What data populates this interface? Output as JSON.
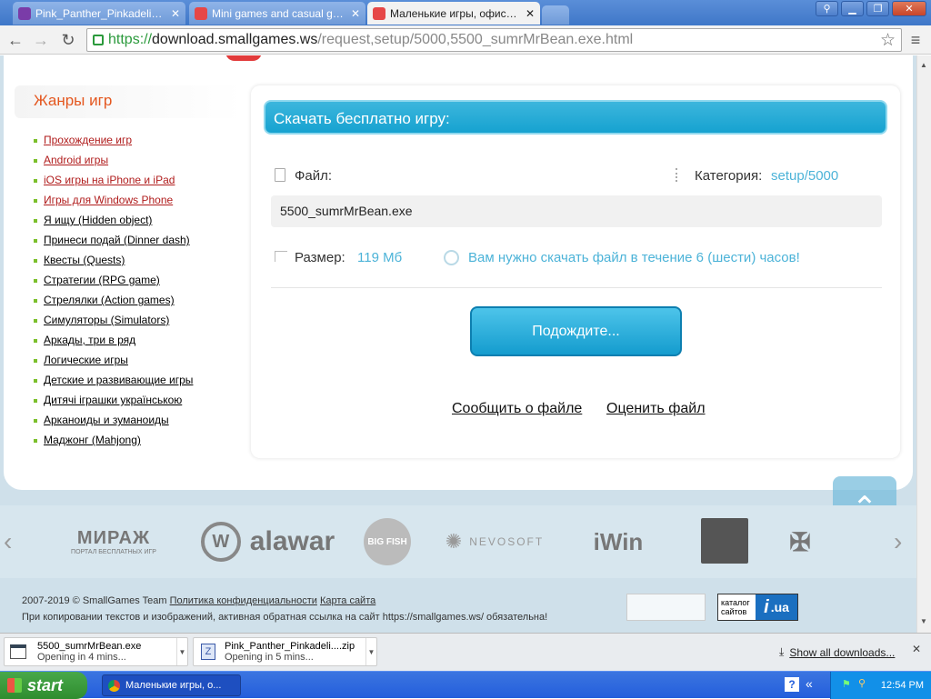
{
  "browser": {
    "tabs": [
      {
        "title": "Pink_Panther_Pinkadelic_Pur",
        "fav_color": "#7a3ca8"
      },
      {
        "title": "Mini games and casual games",
        "fav_color": "#e64747"
      },
      {
        "title": "Маленькие игры, офисные",
        "fav_color": "#e64747"
      }
    ],
    "url": {
      "scheme": "https://",
      "host": "download.smallgames.ws",
      "path": "/request,setup/5000,5500_sumrMrBean.exe.html"
    }
  },
  "sidebar": {
    "title": "Жанры игр",
    "genres": [
      "Прохождение игр",
      "Android игры",
      "iOS игры на iPhone и iPad",
      "Игры для Windows Phone",
      "Я ищу (Hidden object)",
      "Принеси подай (Dinner dash)",
      "Квесты (Quests)",
      "Стратегии (RPG game)",
      "Стрелялки (Action games)",
      "Симуляторы (Simulators)",
      "Аркады, три в ряд",
      "Логические игры",
      "Детские и развивающие игры",
      "Дитячі іграшки українською",
      "Арканоиды и зуманоиды",
      "Маджонг (Mahjong)"
    ]
  },
  "download": {
    "banner": "Скачать бесплатно игру:",
    "file_label": "Файл:",
    "category_label": "Категория:",
    "category_value": "setup/5000",
    "filename": "5500_sumrMrBean.exe",
    "size_label": "Размер:",
    "size_value": "119 Мб",
    "notice": "Вам нужно скачать файл в течение 6 (шести) часов!",
    "wait_button": "Подождите...",
    "report_link": "Сообщить о файле",
    "rate_link": "Оценить файл"
  },
  "partners": {
    "logos": [
      "МИРАЖ",
      "ПОРТАЛ БЕСПЛАТНЫХ ИГР",
      "alawar",
      "BIG FISH",
      "NEVOSOFT",
      "iWin"
    ]
  },
  "footer": {
    "copyright": "2007-2019 © SmallGames Team",
    "privacy": "Политика конфиденциальности",
    "sitemap": "Карта сайта",
    "notice": "При копировании текстов и изображений, активная обратная ссылка на сайт https://smallgames.ws/ обязательна!",
    "badge_text": "каталог сайтов",
    "badge_suffix": ".ua"
  },
  "downloads_bar": {
    "items": [
      {
        "name": "5500_sumrMrBean.exe",
        "status": "Opening in 4 mins..."
      },
      {
        "name": "Pink_Panther_Pinkadeli....zip",
        "status": "Opening in 5 mins..."
      }
    ],
    "show_all": "Show all downloads..."
  },
  "taskbar": {
    "start": "start",
    "active_window": "Маленькие игры, о...",
    "clock": "12:54 PM"
  }
}
